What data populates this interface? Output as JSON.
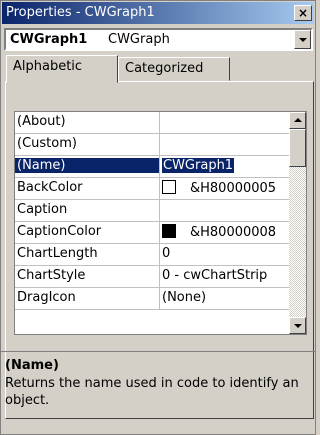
{
  "window": {
    "title": "Properties - CWGraph1",
    "close_glyph": "×"
  },
  "object_selector": {
    "name": "CWGraph1",
    "type": "CWGraph"
  },
  "tabs": [
    {
      "label": "Alphabetic",
      "active": true
    },
    {
      "label": "Categorized",
      "active": false
    }
  ],
  "properties": [
    {
      "name": "(About)",
      "value": ""
    },
    {
      "name": "(Custom)",
      "value": ""
    },
    {
      "name": "(Name)",
      "value": "CWGraph1",
      "selected": true
    },
    {
      "name": "BackColor",
      "value": "&H80000005",
      "swatch": "#ffffff"
    },
    {
      "name": "Caption",
      "value": ""
    },
    {
      "name": "CaptionColor",
      "value": "&H80000008",
      "swatch": "#000000"
    },
    {
      "name": "ChartLength",
      "value": "0"
    },
    {
      "name": "ChartStyle",
      "value": "0 - cwChartStrip"
    },
    {
      "name": "DragIcon",
      "value": "(None)"
    }
  ],
  "description": {
    "title": "(Name)",
    "text": "Returns the name used in code to identify an object."
  },
  "colors": {
    "selection": "#0a246a",
    "face": "#d4d0c8"
  }
}
